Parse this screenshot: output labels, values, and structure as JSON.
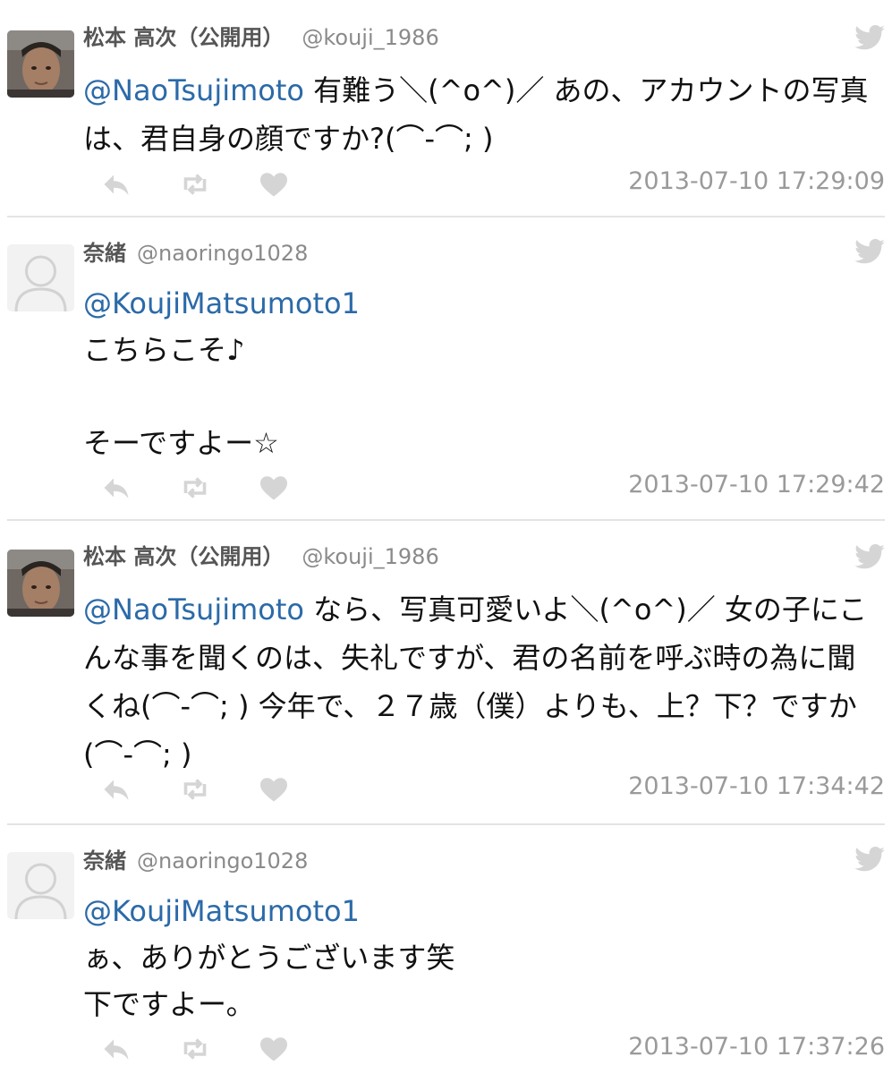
{
  "tweets": [
    {
      "name": "松本 高次（公開用）",
      "handle": "@kouji_1986",
      "avatar": "profile-photo",
      "mention": "@NaoTsujimoto",
      "text": " 有難う＼(^o^)／ あの、アカウントの写真は、君自身の顔ですか?(⌒-⌒; )",
      "timestamp": "2013-07-10 17:29:09"
    },
    {
      "name": "奈緒",
      "handle": "@naoringo1028",
      "avatar": "default-person",
      "mention": "@KoujiMatsumoto1",
      "text": "\nこちらこそ♪\n\nそーですよー☆",
      "timestamp": "2013-07-10 17:29:42"
    },
    {
      "name": "松本 高次（公開用）",
      "handle": "@kouji_1986",
      "avatar": "profile-photo",
      "mention": "@NaoTsujimoto",
      "text": " なら、写真可愛いよ＼(^o^)／ 女の子にこんな事を聞くのは、失礼ですが、君の名前を呼ぶ時の為に聞くね(⌒-⌒; ) 今年で、２７歳（僕）よりも、上？下？ですか(⌒-⌒; )",
      "timestamp": "2013-07-10 17:34:42"
    },
    {
      "name": "奈緒",
      "handle": "@naoringo1028",
      "avatar": "default-person",
      "mention": "@KoujiMatsumoto1",
      "text": "\nぁ、ありがとうございます笑\n下ですよー。",
      "timestamp": "2013-07-10 17:37:26"
    }
  ],
  "icons": {
    "reply": "reply-icon",
    "retweet": "retweet-icon",
    "like": "heart-icon",
    "brand": "twitter-bird-icon"
  },
  "colors": {
    "mention": "#2b6aa8",
    "name": "#555555",
    "meta": "#9a9a9a",
    "icon": "#d5d5d5",
    "divider": "#e4e4e4"
  }
}
